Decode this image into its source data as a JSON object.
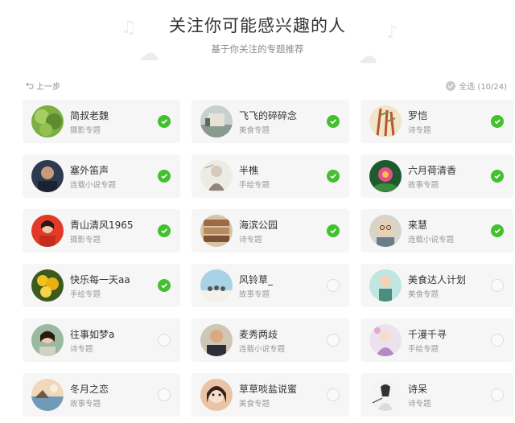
{
  "header": {
    "title": "关注你可能感兴趣的人",
    "subtitle": "基于你关注的专题推荐"
  },
  "nav": {
    "back_label": "上一步",
    "select_all_label": "全选 (10/24)"
  },
  "colors": {
    "accent_green": "#42c02e",
    "card_bg": "#f6f6f6",
    "muted_text": "#999999"
  },
  "users": [
    {
      "name": "简叔老魏",
      "category": "摄影专题",
      "selected": true
    },
    {
      "name": "飞飞的碎碎念",
      "category": "美食专题",
      "selected": true
    },
    {
      "name": "罗恺",
      "category": "诗专题",
      "selected": true
    },
    {
      "name": "塞外笛声",
      "category": "连载小说专题",
      "selected": true
    },
    {
      "name": "半樵",
      "category": "手绘专题",
      "selected": true
    },
    {
      "name": "六月荷清香",
      "category": "故事专题",
      "selected": true
    },
    {
      "name": "青山清风1965",
      "category": "摄影专题",
      "selected": true
    },
    {
      "name": "海滨公园",
      "category": "诗专题",
      "selected": true
    },
    {
      "name": "来慧",
      "category": "连载小说专题",
      "selected": true
    },
    {
      "name": "快乐每一天aa",
      "category": "手绘专题",
      "selected": true
    },
    {
      "name": "风铃草_",
      "category": "故事专题",
      "selected": false
    },
    {
      "name": "美食达人计划",
      "category": "美食专题",
      "selected": false
    },
    {
      "name": "往事如梦a",
      "category": "诗专题",
      "selected": false
    },
    {
      "name": "麦秀两歧",
      "category": "连载小说专题",
      "selected": false
    },
    {
      "name": "千漫千寻",
      "category": "手绘专题",
      "selected": false
    },
    {
      "name": "冬月之恋",
      "category": "故事专题",
      "selected": false
    },
    {
      "name": "草草啖盐说蜜",
      "category": "美食专题",
      "selected": false
    },
    {
      "name": "诗呆",
      "category": "诗专题",
      "selected": false
    }
  ]
}
